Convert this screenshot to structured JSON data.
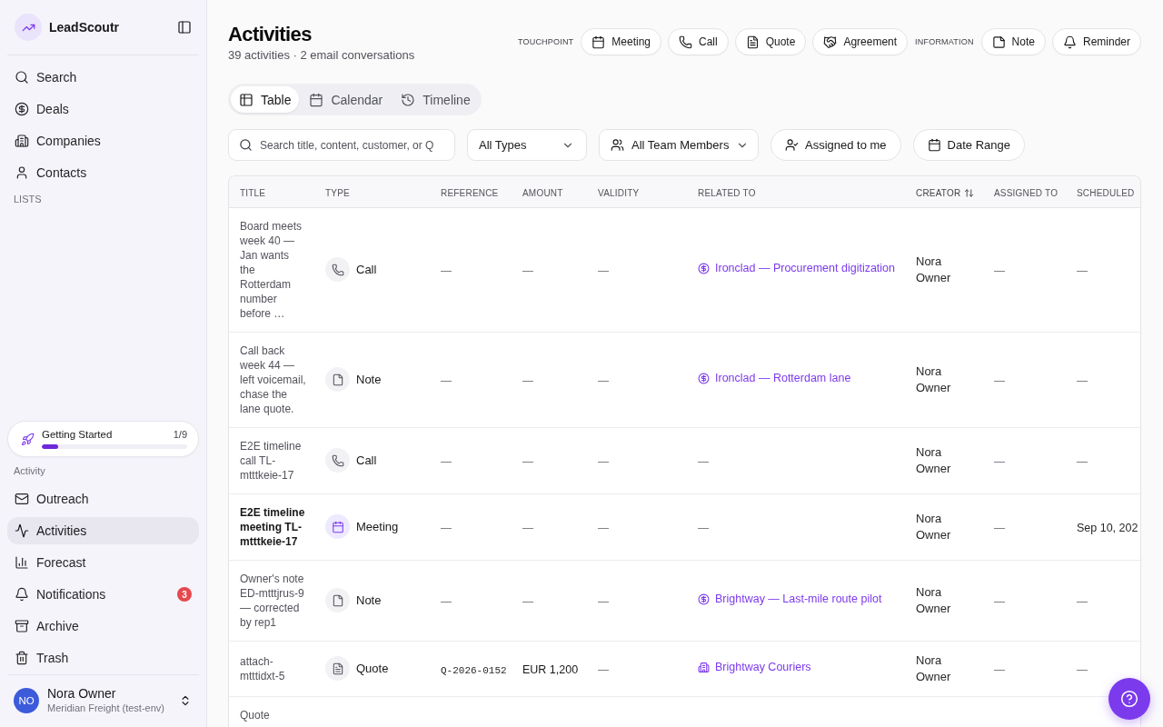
{
  "sidebar": {
    "brand": "LeadScoutr",
    "nav": [
      {
        "kind": "search",
        "label": "Search",
        "selected": false
      },
      {
        "kind": "deals",
        "label": "Deals",
        "selected": false
      },
      {
        "kind": "companies",
        "label": "Companies",
        "selected": false
      },
      {
        "kind": "contacts",
        "label": "Contacts",
        "selected": false
      }
    ],
    "lists_label": "LISTS",
    "getting_started": {
      "title": "Getting Started",
      "progress": "1/9",
      "level": 0.111
    },
    "activity_label": "Activity",
    "activity_nav": [
      {
        "kind": "outreach",
        "label": "Outreach",
        "selected": false
      },
      {
        "kind": "activities",
        "label": "Activities",
        "selected": true
      },
      {
        "kind": "forecast",
        "label": "Forecast",
        "selected": false
      },
      {
        "kind": "notifications",
        "label": "Notifications",
        "selected": false,
        "badge": "3"
      },
      {
        "kind": "archive",
        "label": "Archive",
        "selected": false
      },
      {
        "kind": "trash",
        "label": "Trash",
        "selected": false
      }
    ],
    "user": {
      "initials": "NO",
      "name": "Nora Owner",
      "org": "Meridian Freight (test-env)"
    }
  },
  "header": {
    "title": "Activities",
    "subtitle": "39 activities · 2 email conversations",
    "action_groups": [
      {
        "label": "TOUCHPOINT",
        "buttons": [
          {
            "kind": "meeting",
            "label": "Meeting"
          },
          {
            "kind": "call",
            "label": "Call"
          },
          {
            "kind": "quote",
            "label": "Quote"
          },
          {
            "kind": "agreement",
            "label": "Agreement"
          }
        ]
      },
      {
        "label": "INFORMATION",
        "buttons": [
          {
            "kind": "note",
            "label": "Note"
          },
          {
            "kind": "reminder",
            "label": "Reminder"
          }
        ]
      }
    ]
  },
  "view_tabs": [
    {
      "kind": "table",
      "label": "Table",
      "selected": true
    },
    {
      "kind": "calendar",
      "label": "Calendar",
      "selected": false
    },
    {
      "kind": "timeline",
      "label": "Timeline",
      "selected": false
    }
  ],
  "filters": {
    "search": {
      "placeholder": "Search title, content, customer, or Q"
    },
    "type_select": {
      "value": "All Types"
    },
    "member_select": {
      "value": "All Team Members"
    },
    "buttons": [
      {
        "kind": "assigned",
        "label": "Assigned to me"
      },
      {
        "kind": "date",
        "label": "Date Range"
      }
    ]
  },
  "table": {
    "columns": [
      {
        "label": "TITLE",
        "sortable": false
      },
      {
        "label": "TYPE",
        "sortable": false
      },
      {
        "label": "REFERENCE",
        "sortable": false
      },
      {
        "label": "AMOUNT",
        "sortable": false
      },
      {
        "label": "VALIDITY",
        "sortable": false
      },
      {
        "label": "RELATED TO",
        "sortable": false
      },
      {
        "label": "CREATOR",
        "sortable": true
      },
      {
        "label": "ASSIGNED TO",
        "sortable": false
      },
      {
        "label": "SCHEDULED",
        "sortable": false
      }
    ],
    "rows": [
      {
        "title": "Board meets week 40 — Jan wants the Rotterdam number before …",
        "emphasized": false,
        "type": {
          "kind": "call",
          "label": "Call"
        },
        "reference": {
          "kind": "empty",
          "text": "—"
        },
        "amount": {
          "kind": "empty",
          "text": "—"
        },
        "validity": {
          "kind": "empty",
          "text": "—"
        },
        "related": {
          "kind": "deal",
          "text": "Ironclad — Procurement digitization"
        },
        "creator": "Nora Owner",
        "assigned_to": {
          "kind": "empty",
          "text": "—"
        },
        "scheduled": {
          "kind": "empty",
          "text": "—"
        }
      },
      {
        "title": "Call back week 44 — left voicemail, chase the lane quote.",
        "emphasized": false,
        "type": {
          "kind": "note",
          "label": "Note"
        },
        "reference": {
          "kind": "empty",
          "text": "—"
        },
        "amount": {
          "kind": "empty",
          "text": "—"
        },
        "validity": {
          "kind": "empty",
          "text": "—"
        },
        "related": {
          "kind": "deal",
          "text": "Ironclad — Rotterdam lane"
        },
        "creator": "Nora Owner",
        "assigned_to": {
          "kind": "empty",
          "text": "—"
        },
        "scheduled": {
          "kind": "empty",
          "text": "—"
        }
      },
      {
        "title": "E2E timeline call TL-mtttkeie-17",
        "emphasized": false,
        "type": {
          "kind": "call",
          "label": "Call"
        },
        "reference": {
          "kind": "empty",
          "text": "—"
        },
        "amount": {
          "kind": "empty",
          "text": "—"
        },
        "validity": {
          "kind": "empty",
          "text": "—"
        },
        "related": {
          "kind": "none",
          "text": "—"
        },
        "creator": "Nora Owner",
        "assigned_to": {
          "kind": "empty",
          "text": "—"
        },
        "scheduled": {
          "kind": "empty",
          "text": "—"
        }
      },
      {
        "title": "E2E timeline meeting TL-mtttkeie-17",
        "emphasized": true,
        "type": {
          "kind": "meeting",
          "label": "Meeting"
        },
        "reference": {
          "kind": "empty",
          "text": "—"
        },
        "amount": {
          "kind": "empty",
          "text": "—"
        },
        "validity": {
          "kind": "empty",
          "text": "—"
        },
        "related": {
          "kind": "none",
          "text": "—"
        },
        "creator": "Nora Owner",
        "assigned_to": {
          "kind": "empty",
          "text": "—"
        },
        "scheduled": {
          "kind": "value",
          "text": "Sep 10, 202"
        }
      },
      {
        "title": "Owner's note ED-mtttjrus-9 — corrected by rep1",
        "emphasized": false,
        "type": {
          "kind": "note",
          "label": "Note"
        },
        "reference": {
          "kind": "empty",
          "text": "—"
        },
        "amount": {
          "kind": "empty",
          "text": "—"
        },
        "validity": {
          "kind": "empty",
          "text": "—"
        },
        "related": {
          "kind": "deal",
          "text": "Brightway — Last-mile route pilot"
        },
        "creator": "Nora Owner",
        "assigned_to": {
          "kind": "empty",
          "text": "—"
        },
        "scheduled": {
          "kind": "empty",
          "text": "—"
        }
      },
      {
        "title": "attach-mtttidxt-5",
        "emphasized": false,
        "type": {
          "kind": "quote",
          "label": "Quote"
        },
        "reference": {
          "kind": "value",
          "text": "Q-2026-0152"
        },
        "amount": {
          "kind": "value",
          "text": "EUR 1,200"
        },
        "validity": {
          "kind": "empty",
          "text": "—"
        },
        "related": {
          "kind": "company",
          "text": "Brightway Couriers"
        },
        "creator": "Nora Owner",
        "assigned_to": {
          "kind": "empty",
          "text": "—"
        },
        "scheduled": {
          "kind": "empty",
          "text": "—"
        }
      },
      {
        "title": "Quote",
        "emphasized": false
      }
    ]
  }
}
